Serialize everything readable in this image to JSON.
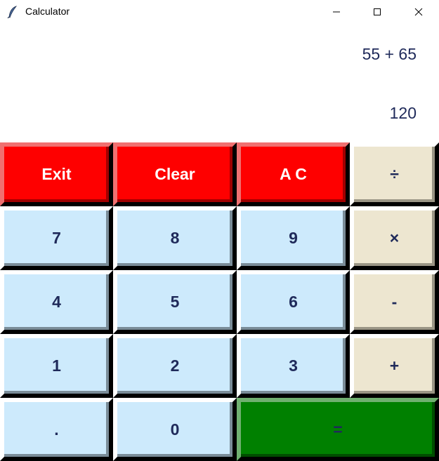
{
  "window": {
    "title": "Calculator",
    "app_icon": "feather-icon",
    "controls": [
      "minimize-icon",
      "maximize-icon",
      "close-icon"
    ]
  },
  "display": {
    "expression": "55 + 65",
    "result": "120"
  },
  "keys": {
    "exit": "Exit",
    "clear": "Clear",
    "ac": "A C",
    "divide": "÷",
    "seven": "7",
    "eight": "8",
    "nine": "9",
    "multiply": "×",
    "four": "4",
    "five": "5",
    "six": "6",
    "minus": "-",
    "one": "1",
    "two": "2",
    "three": "3",
    "plus": "+",
    "dot": ".",
    "zero": "0",
    "equals": "="
  },
  "colors": {
    "number_key": "#cdeafc",
    "operator_key": "#ede6d0",
    "control_key": "#fe0000",
    "equals_key": "#008000",
    "text": "#1f2a5a"
  }
}
